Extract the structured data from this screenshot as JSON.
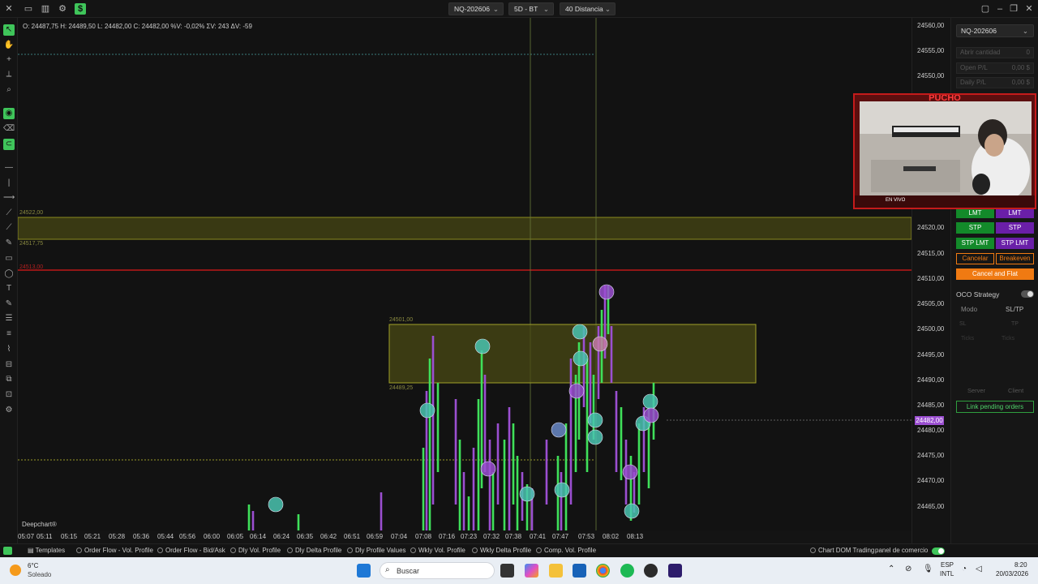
{
  "top_bar": {
    "instrument": "NQ-202606",
    "timeframe": "5D - BT",
    "distance": "40 Distancia"
  },
  "chart": {
    "ohlc": "O: 24487,75  H: 24489,50  L: 24482,00  C: 24482,00  %V: -0,02%  ΣV: 243  ΔV: -59",
    "zone_upper_top_label": "24522,00",
    "zone_upper_bottom_label": "24517,75",
    "red_line_label": "24513,00",
    "zone_mid_top_label": "24501,00",
    "zone_mid_bottom_label": "24489,25",
    "watermark": "Deepchart®",
    "current_price": "24482,00",
    "price_labels": [
      "24560,00",
      "24555,00",
      "24550,00",
      "24520,00",
      "24515,00",
      "24510,00",
      "24505,00",
      "24500,00",
      "24495,00",
      "24490,00",
      "24485,00",
      "24480,00",
      "24475,00",
      "24470,00",
      "24465,00"
    ],
    "time_labels": [
      "05:07",
      "05:11",
      "05:15",
      "05:21",
      "05:28",
      "05:36",
      "05:44",
      "05:56",
      "06:00",
      "06:05",
      "06:14",
      "06:24",
      "06:35",
      "06:42",
      "06:51",
      "06:59",
      "07:04",
      "07:08",
      "07:16",
      "07:23",
      "07:32",
      "07:38",
      "07:41",
      "07:47",
      "07:53",
      "08:02",
      "08:13"
    ]
  },
  "right_panel": {
    "instrument": "NQ-202606",
    "open_qty_label": "Abrir cantidad",
    "open_qty_value": "0",
    "open_pl_label": "Open P/L",
    "open_pl_value": "0,00 $",
    "daily_pl_label": "Daily P/L",
    "daily_pl_value": "0,00 $",
    "lmt_buy": "LMT",
    "lmt_sell": "LMT",
    "stp_buy": "STP",
    "stp_sell": "STP",
    "stplmt_buy": "STP LMT",
    "stplmt_sell": "STP LMT",
    "cancel": "Cancelar",
    "breakeven": "Breakeven",
    "cancel_flat": "Cancel and Flat",
    "oco_label": "OCO Strategy",
    "mode_label": "Modo",
    "mode_value": "SL/TP",
    "sl_label": "SL",
    "tp_label": "TP",
    "ticks_label_1": "Ticks",
    "ticks_label_2": "Ticks",
    "server_label": "Server",
    "client_label": "Client",
    "link_pending": "Link pending orders"
  },
  "webcam": {
    "banner": "PUCHO",
    "live_label": "EN VIVO"
  },
  "bottom_tabs": {
    "templates": "Templates",
    "items": [
      "Order Flow - Vol. Profile",
      "Order Flow - Bid/Ask",
      "Dly Vol. Profile",
      "Dly Delta Profile",
      "Dly Profile Values",
      "Wkly Vol. Profile",
      "Wkly Delta Profile",
      "Comp. Vol. Profile"
    ],
    "chart_dom": "Chart DOM Trading",
    "panel": "panel de comercio"
  },
  "taskbar": {
    "temperature": "6°C",
    "weather": "Soleado",
    "search_placeholder": "Buscar",
    "lang": "ESP",
    "lang_sub": "INTL",
    "time": "8:20",
    "date": "20/03/2026"
  },
  "colors": {
    "green": "#3fe05a",
    "purple": "#9b4fd1",
    "zone": "#8a8a1f",
    "red_line": "#e01818",
    "accent_orange": "#f07a12"
  }
}
